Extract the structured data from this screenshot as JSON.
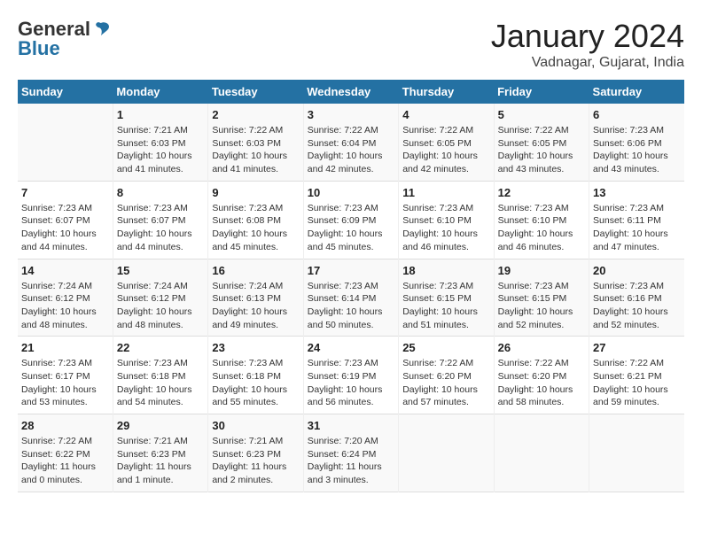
{
  "header": {
    "logo_line1": "General",
    "logo_line2": "Blue",
    "month": "January 2024",
    "location": "Vadnagar, Gujarat, India"
  },
  "weekdays": [
    "Sunday",
    "Monday",
    "Tuesday",
    "Wednesday",
    "Thursday",
    "Friday",
    "Saturday"
  ],
  "weeks": [
    [
      {
        "day": "",
        "sunrise": "",
        "sunset": "",
        "daylight": ""
      },
      {
        "day": "1",
        "sunrise": "Sunrise: 7:21 AM",
        "sunset": "Sunset: 6:03 PM",
        "daylight": "Daylight: 10 hours and 41 minutes."
      },
      {
        "day": "2",
        "sunrise": "Sunrise: 7:22 AM",
        "sunset": "Sunset: 6:03 PM",
        "daylight": "Daylight: 10 hours and 41 minutes."
      },
      {
        "day": "3",
        "sunrise": "Sunrise: 7:22 AM",
        "sunset": "Sunset: 6:04 PM",
        "daylight": "Daylight: 10 hours and 42 minutes."
      },
      {
        "day": "4",
        "sunrise": "Sunrise: 7:22 AM",
        "sunset": "Sunset: 6:05 PM",
        "daylight": "Daylight: 10 hours and 42 minutes."
      },
      {
        "day": "5",
        "sunrise": "Sunrise: 7:22 AM",
        "sunset": "Sunset: 6:05 PM",
        "daylight": "Daylight: 10 hours and 43 minutes."
      },
      {
        "day": "6",
        "sunrise": "Sunrise: 7:23 AM",
        "sunset": "Sunset: 6:06 PM",
        "daylight": "Daylight: 10 hours and 43 minutes."
      }
    ],
    [
      {
        "day": "7",
        "sunrise": "Sunrise: 7:23 AM",
        "sunset": "Sunset: 6:07 PM",
        "daylight": "Daylight: 10 hours and 44 minutes."
      },
      {
        "day": "8",
        "sunrise": "Sunrise: 7:23 AM",
        "sunset": "Sunset: 6:07 PM",
        "daylight": "Daylight: 10 hours and 44 minutes."
      },
      {
        "day": "9",
        "sunrise": "Sunrise: 7:23 AM",
        "sunset": "Sunset: 6:08 PM",
        "daylight": "Daylight: 10 hours and 45 minutes."
      },
      {
        "day": "10",
        "sunrise": "Sunrise: 7:23 AM",
        "sunset": "Sunset: 6:09 PM",
        "daylight": "Daylight: 10 hours and 45 minutes."
      },
      {
        "day": "11",
        "sunrise": "Sunrise: 7:23 AM",
        "sunset": "Sunset: 6:10 PM",
        "daylight": "Daylight: 10 hours and 46 minutes."
      },
      {
        "day": "12",
        "sunrise": "Sunrise: 7:23 AM",
        "sunset": "Sunset: 6:10 PM",
        "daylight": "Daylight: 10 hours and 46 minutes."
      },
      {
        "day": "13",
        "sunrise": "Sunrise: 7:23 AM",
        "sunset": "Sunset: 6:11 PM",
        "daylight": "Daylight: 10 hours and 47 minutes."
      }
    ],
    [
      {
        "day": "14",
        "sunrise": "Sunrise: 7:24 AM",
        "sunset": "Sunset: 6:12 PM",
        "daylight": "Daylight: 10 hours and 48 minutes."
      },
      {
        "day": "15",
        "sunrise": "Sunrise: 7:24 AM",
        "sunset": "Sunset: 6:12 PM",
        "daylight": "Daylight: 10 hours and 48 minutes."
      },
      {
        "day": "16",
        "sunrise": "Sunrise: 7:24 AM",
        "sunset": "Sunset: 6:13 PM",
        "daylight": "Daylight: 10 hours and 49 minutes."
      },
      {
        "day": "17",
        "sunrise": "Sunrise: 7:23 AM",
        "sunset": "Sunset: 6:14 PM",
        "daylight": "Daylight: 10 hours and 50 minutes."
      },
      {
        "day": "18",
        "sunrise": "Sunrise: 7:23 AM",
        "sunset": "Sunset: 6:15 PM",
        "daylight": "Daylight: 10 hours and 51 minutes."
      },
      {
        "day": "19",
        "sunrise": "Sunrise: 7:23 AM",
        "sunset": "Sunset: 6:15 PM",
        "daylight": "Daylight: 10 hours and 52 minutes."
      },
      {
        "day": "20",
        "sunrise": "Sunrise: 7:23 AM",
        "sunset": "Sunset: 6:16 PM",
        "daylight": "Daylight: 10 hours and 52 minutes."
      }
    ],
    [
      {
        "day": "21",
        "sunrise": "Sunrise: 7:23 AM",
        "sunset": "Sunset: 6:17 PM",
        "daylight": "Daylight: 10 hours and 53 minutes."
      },
      {
        "day": "22",
        "sunrise": "Sunrise: 7:23 AM",
        "sunset": "Sunset: 6:18 PM",
        "daylight": "Daylight: 10 hours and 54 minutes."
      },
      {
        "day": "23",
        "sunrise": "Sunrise: 7:23 AM",
        "sunset": "Sunset: 6:18 PM",
        "daylight": "Daylight: 10 hours and 55 minutes."
      },
      {
        "day": "24",
        "sunrise": "Sunrise: 7:23 AM",
        "sunset": "Sunset: 6:19 PM",
        "daylight": "Daylight: 10 hours and 56 minutes."
      },
      {
        "day": "25",
        "sunrise": "Sunrise: 7:22 AM",
        "sunset": "Sunset: 6:20 PM",
        "daylight": "Daylight: 10 hours and 57 minutes."
      },
      {
        "day": "26",
        "sunrise": "Sunrise: 7:22 AM",
        "sunset": "Sunset: 6:20 PM",
        "daylight": "Daylight: 10 hours and 58 minutes."
      },
      {
        "day": "27",
        "sunrise": "Sunrise: 7:22 AM",
        "sunset": "Sunset: 6:21 PM",
        "daylight": "Daylight: 10 hours and 59 minutes."
      }
    ],
    [
      {
        "day": "28",
        "sunrise": "Sunrise: 7:22 AM",
        "sunset": "Sunset: 6:22 PM",
        "daylight": "Daylight: 11 hours and 0 minutes."
      },
      {
        "day": "29",
        "sunrise": "Sunrise: 7:21 AM",
        "sunset": "Sunset: 6:23 PM",
        "daylight": "Daylight: 11 hours and 1 minute."
      },
      {
        "day": "30",
        "sunrise": "Sunrise: 7:21 AM",
        "sunset": "Sunset: 6:23 PM",
        "daylight": "Daylight: 11 hours and 2 minutes."
      },
      {
        "day": "31",
        "sunrise": "Sunrise: 7:20 AM",
        "sunset": "Sunset: 6:24 PM",
        "daylight": "Daylight: 11 hours and 3 minutes."
      },
      {
        "day": "",
        "sunrise": "",
        "sunset": "",
        "daylight": ""
      },
      {
        "day": "",
        "sunrise": "",
        "sunset": "",
        "daylight": ""
      },
      {
        "day": "",
        "sunrise": "",
        "sunset": "",
        "daylight": ""
      }
    ]
  ]
}
